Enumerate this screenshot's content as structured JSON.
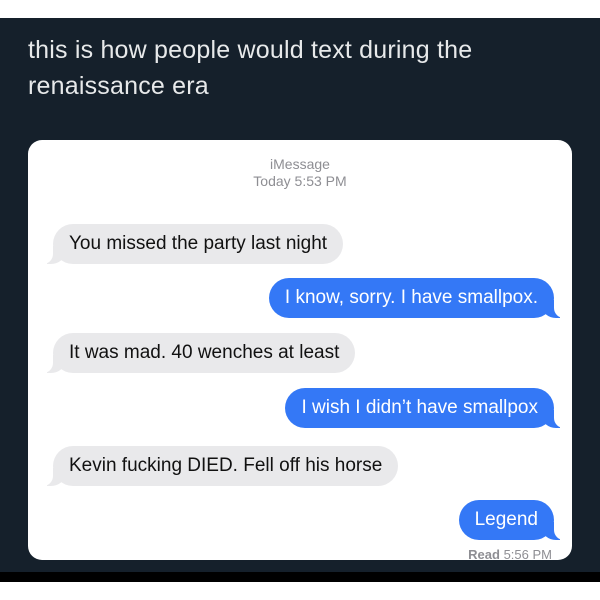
{
  "post": {
    "text": "this is how people would text during the renaissance era"
  },
  "imessage": {
    "service": "iMessage",
    "timestamp": "Today 5:53 PM",
    "messages": [
      {
        "direction": "incoming",
        "text": "You missed the party last night"
      },
      {
        "direction": "outgoing",
        "text": "I know, sorry. I have smallpox."
      },
      {
        "direction": "incoming",
        "text": "It was mad. 40 wenches at least"
      },
      {
        "direction": "outgoing",
        "text": "I wish I didn’t have smallpox"
      },
      {
        "direction": "incoming",
        "text": "Kevin fucking DIED. Fell off his horse"
      },
      {
        "direction": "outgoing",
        "text": "Legend"
      }
    ],
    "receipt_status": "Read",
    "receipt_time": "5:56 PM"
  },
  "colors": {
    "background": "#15202b",
    "outgoing_bubble": "#3478f6",
    "incoming_bubble": "#e9e9eb",
    "meta_text": "#8e8e93"
  }
}
